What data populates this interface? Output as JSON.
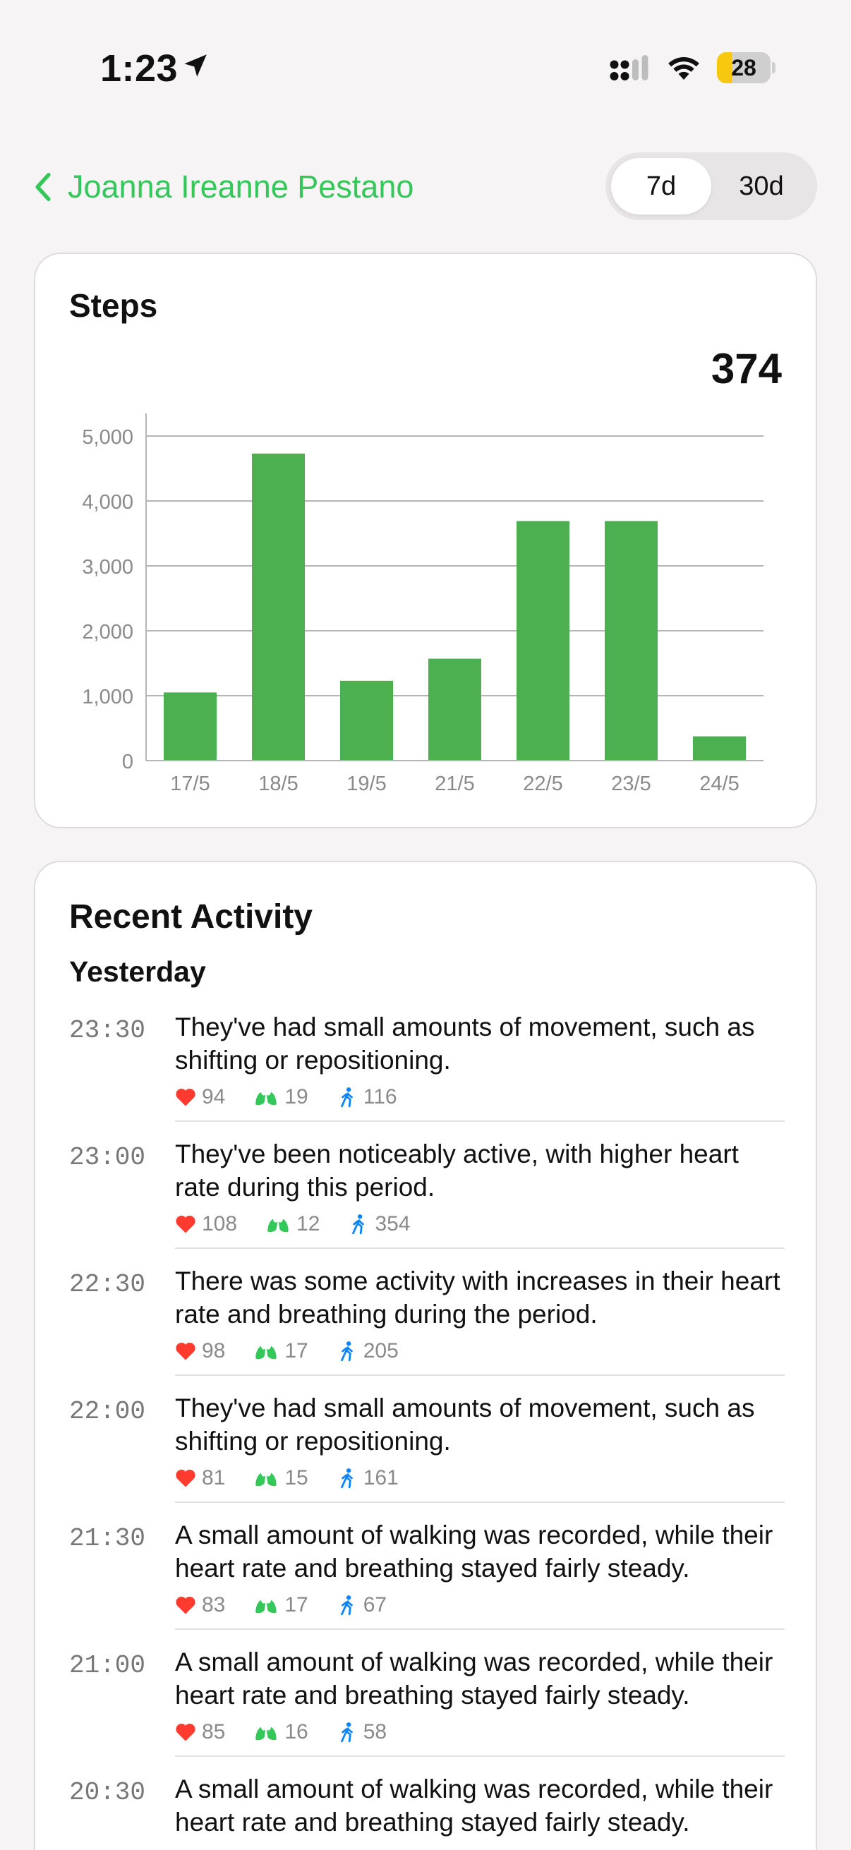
{
  "status_bar": {
    "time": "1:23",
    "battery": "28",
    "battery_level": 0.28
  },
  "nav": {
    "back_label": "Joanna Ireanne Pestano",
    "segments": [
      "7d",
      "30d"
    ],
    "selected_segment": "7d"
  },
  "steps": {
    "title": "Steps",
    "total": "374"
  },
  "chart_data": {
    "type": "bar",
    "categories": [
      "17/5",
      "18/5",
      "19/5",
      "21/5",
      "22/5",
      "23/5",
      "24/5"
    ],
    "values": [
      1050,
      4730,
      1230,
      1570,
      3690,
      3690,
      374
    ],
    "ylim": [
      0,
      5000
    ],
    "yticks": [
      0,
      1000,
      2000,
      3000,
      4000,
      5000
    ],
    "ytick_labels": [
      "0",
      "1,000",
      "2,000",
      "3,000",
      "4,000",
      "5,000"
    ],
    "grid": true,
    "color": "#4caf50"
  },
  "activity": {
    "title": "Recent Activity",
    "day": "Yesterday",
    "entries": [
      {
        "time": "23:30",
        "text": "They've had small amounts of movement, such as shifting or repositioning.",
        "heart": "94",
        "breath": "19",
        "steps": "116"
      },
      {
        "time": "23:00",
        "text": "They've been noticeably active, with higher heart rate during this period.",
        "heart": "108",
        "breath": "12",
        "steps": "354"
      },
      {
        "time": "22:30",
        "text": "There was some activity with increases in their heart rate and breathing during the period.",
        "heart": "98",
        "breath": "17",
        "steps": "205"
      },
      {
        "time": "22:00",
        "text": "They've had small amounts of movement, such as shifting or repositioning.",
        "heart": "81",
        "breath": "15",
        "steps": "161"
      },
      {
        "time": "21:30",
        "text": "A small amount of walking was recorded, while their heart rate and breathing stayed fairly steady.",
        "heart": "83",
        "breath": "17",
        "steps": "67"
      },
      {
        "time": "21:00",
        "text": "A small amount of walking was recorded, while their heart rate and breathing stayed fairly steady.",
        "heart": "85",
        "breath": "16",
        "steps": "58"
      },
      {
        "time": "20:30",
        "text": "A small amount of walking was recorded, while their heart rate and breathing stayed fairly steady.",
        "heart": "",
        "breath": "",
        "steps": ""
      }
    ]
  },
  "colors": {
    "accent": "#34c759",
    "bar": "#4caf50",
    "heart": "#ff3b30",
    "lungs": "#34c759",
    "steps": "#0a84ff"
  },
  "icons": {
    "location": "location-arrow-icon",
    "signal": "cellular-signal-icon",
    "wifi": "wifi-icon",
    "back": "chevron-left-icon",
    "heart": "heart-icon",
    "lungs": "lungs-icon",
    "steps": "walking-icon"
  }
}
